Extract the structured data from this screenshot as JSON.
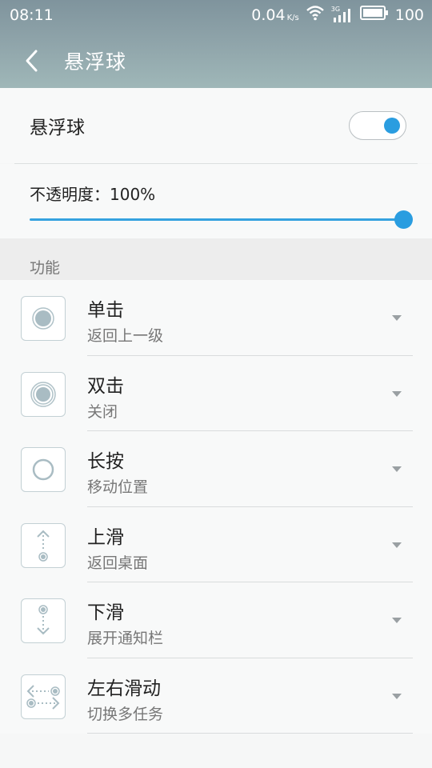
{
  "status_bar": {
    "time": "08:11",
    "speed": "0.04",
    "speed_unit": "K/s",
    "network": "3G",
    "battery": "100"
  },
  "header": {
    "title": "悬浮球",
    "back_icon": "chevron-left-icon"
  },
  "toggle": {
    "label": "悬浮球",
    "enabled": true
  },
  "opacity": {
    "label": "不透明度：100%",
    "value": 100
  },
  "section": {
    "title": "功能"
  },
  "items": [
    {
      "title": "单击",
      "value": "返回上一级",
      "icon": "single-tap-icon"
    },
    {
      "title": "双击",
      "value": "关闭",
      "icon": "double-tap-icon"
    },
    {
      "title": "长按",
      "value": "移动位置",
      "icon": "long-press-icon"
    },
    {
      "title": "上滑",
      "value": "返回桌面",
      "icon": "swipe-up-icon"
    },
    {
      "title": "下滑",
      "value": "展开通知栏",
      "icon": "swipe-down-icon"
    },
    {
      "title": "左右滑动",
      "value": "切换多任务",
      "icon": "swipe-horizontal-icon"
    }
  ],
  "colors": {
    "accent": "#2a9de0",
    "header": "#8ea3a9"
  }
}
